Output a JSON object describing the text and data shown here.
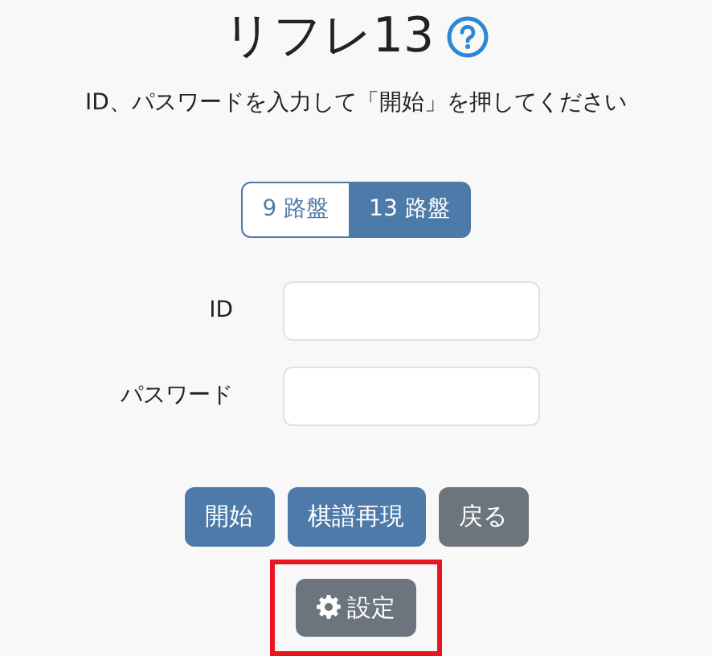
{
  "title": "リフレ13",
  "subtitle": "ID、パスワードを入力して「開始」を押してください",
  "board_sizes": [
    {
      "label": "9 路盤",
      "selected": false
    },
    {
      "label": "13 路盤",
      "selected": true
    }
  ],
  "fields": [
    {
      "label": "ID"
    },
    {
      "label": "パスワード"
    }
  ],
  "buttons": [
    {
      "label": "開始",
      "kind": "primary"
    },
    {
      "label": "棋譜再現",
      "kind": "primary"
    },
    {
      "label": "戻る",
      "kind": "secondary"
    }
  ],
  "settings_button": {
    "label": "設定",
    "highlighted": true
  }
}
